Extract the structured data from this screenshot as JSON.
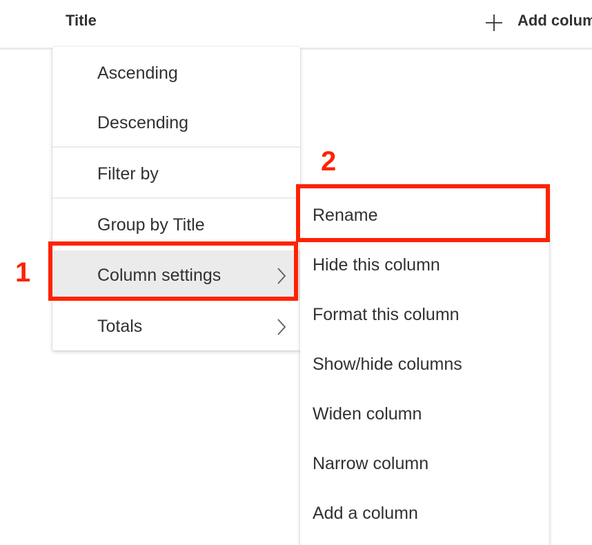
{
  "header": {
    "column_title": "Title",
    "add_column_label": "Add column"
  },
  "menu": {
    "items": [
      {
        "label": "Ascending"
      },
      {
        "label": "Descending"
      },
      {
        "label": "Filter by"
      },
      {
        "label": "Group by Title"
      },
      {
        "label": "Column settings"
      },
      {
        "label": "Totals"
      }
    ]
  },
  "submenu": {
    "items": [
      {
        "label": "Rename"
      },
      {
        "label": "Hide this column"
      },
      {
        "label": "Format this column"
      },
      {
        "label": "Show/hide columns"
      },
      {
        "label": "Widen column"
      },
      {
        "label": "Narrow column"
      },
      {
        "label": "Add a column"
      }
    ]
  },
  "annotations": {
    "step1": "1",
    "step2": "2",
    "color": "#ff2200"
  },
  "icons": {
    "add": "plus-icon",
    "submenu_arrow": "chevron-right-icon"
  }
}
